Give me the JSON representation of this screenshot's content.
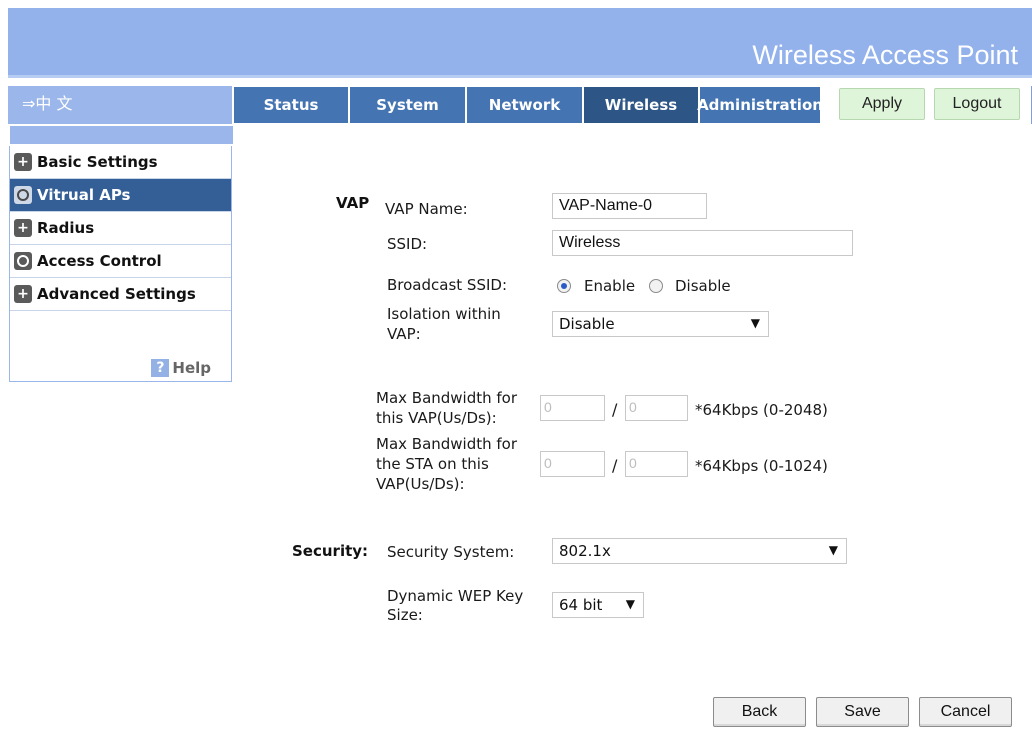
{
  "header": {
    "title": "Wireless Access Point"
  },
  "nav": {
    "language": "⇒中 文",
    "tabs": [
      "Status",
      "System",
      "Network",
      "Wireless",
      "Administration"
    ],
    "active_tab": "Wireless",
    "apply_label": "Apply",
    "logout_label": "Logout"
  },
  "sidebar": {
    "items": [
      {
        "label": "Basic Settings",
        "icon": "plus-icon"
      },
      {
        "label": "Vitrual APs",
        "icon": "circle-icon"
      },
      {
        "label": "Radius",
        "icon": "plus-icon"
      },
      {
        "label": "Access Control",
        "icon": "circle-icon"
      },
      {
        "label": "Advanced Settings",
        "icon": "plus-icon"
      }
    ],
    "active_item": "Vitrual APs",
    "help_label": "Help"
  },
  "form": {
    "vap_section": "VAP",
    "vap_name_label": "VAP Name:",
    "vap_name_value": "VAP-Name-0",
    "ssid_label": "SSID:",
    "ssid_value": "Wireless",
    "broadcast_label": "Broadcast SSID:",
    "broadcast_options": [
      "Enable",
      "Disable"
    ],
    "broadcast_selected": "Enable",
    "isolation_label_1": "Isolation within",
    "isolation_label_2": "VAP:",
    "isolation_value": "Disable",
    "bw_vap_label_1": "Max Bandwidth for",
    "bw_vap_label_2": "this VAP(Us/Ds):",
    "bw_vap_up": "0",
    "bw_vap_down": "0",
    "bw_vap_unit": "*64Kbps (0-2048)",
    "bw_sta_label_1": "Max Bandwidth for",
    "bw_sta_label_2": "the STA on this",
    "bw_sta_label_3": "VAP(Us/Ds):",
    "bw_sta_up": "0",
    "bw_sta_down": "0",
    "bw_sta_unit": "*64Kbps (0-1024)",
    "slash": "/",
    "security_section": "Security:",
    "security_system_label": "Security System:",
    "security_system_value": "802.1x",
    "wep_label_1": "Dynamic WEP Key",
    "wep_label_2": "Size:",
    "wep_value": "64 bit"
  },
  "footer": {
    "back_label": "Back",
    "save_label": "Save",
    "cancel_label": "Cancel"
  },
  "colors": {
    "banner": "#93b2ec",
    "tab": "#4474b2",
    "tab_active": "#2d5687",
    "sidebar_active": "#345f96",
    "apply_bg": "#dff5da"
  }
}
